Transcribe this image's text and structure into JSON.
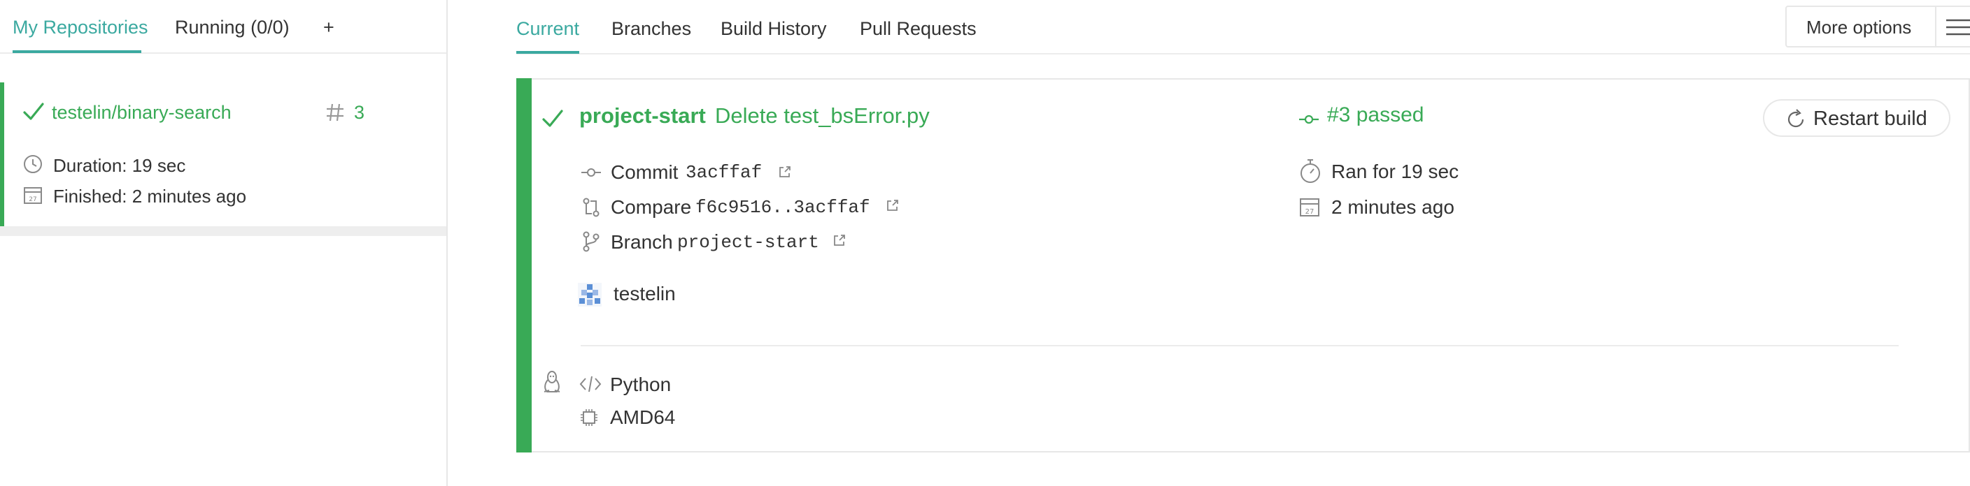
{
  "sidebar": {
    "tabs": [
      {
        "label": "My Repositories",
        "active": true
      },
      {
        "label": "Running (0/0)",
        "active": false
      },
      {
        "label": "+",
        "active": false
      }
    ],
    "repo": {
      "name": "testelin/binary-search",
      "build_number": "3",
      "duration": "Duration: 19 sec",
      "finished": "Finished: 2 minutes ago",
      "status_icon": "check-icon"
    }
  },
  "main": {
    "tabs": [
      {
        "label": "Current",
        "active": true
      },
      {
        "label": "Branches",
        "active": false
      },
      {
        "label": "Build History",
        "active": false
      },
      {
        "label": "Pull Requests",
        "active": false
      }
    ],
    "more_options": "More options",
    "build": {
      "branch_title": "project-start",
      "commit_message": "Delete test_bsError.py",
      "status": "#3 passed",
      "restart_label": "Restart build",
      "commit_label": "Commit",
      "commit_hash": "3acffaf",
      "compare_label": "Compare",
      "compare_range": "f6c9516..3acffaf",
      "branch_label": "Branch",
      "branch_name": "project-start",
      "author": "testelin",
      "ran_for": "Ran for 19 sec",
      "finished_ago": "2 minutes ago",
      "language": "Python",
      "arch": "AMD64"
    }
  },
  "colors": {
    "accent": "#3ba9a0",
    "passed": "#39aa56",
    "text": "#333333",
    "border": "#e7e7e7"
  }
}
